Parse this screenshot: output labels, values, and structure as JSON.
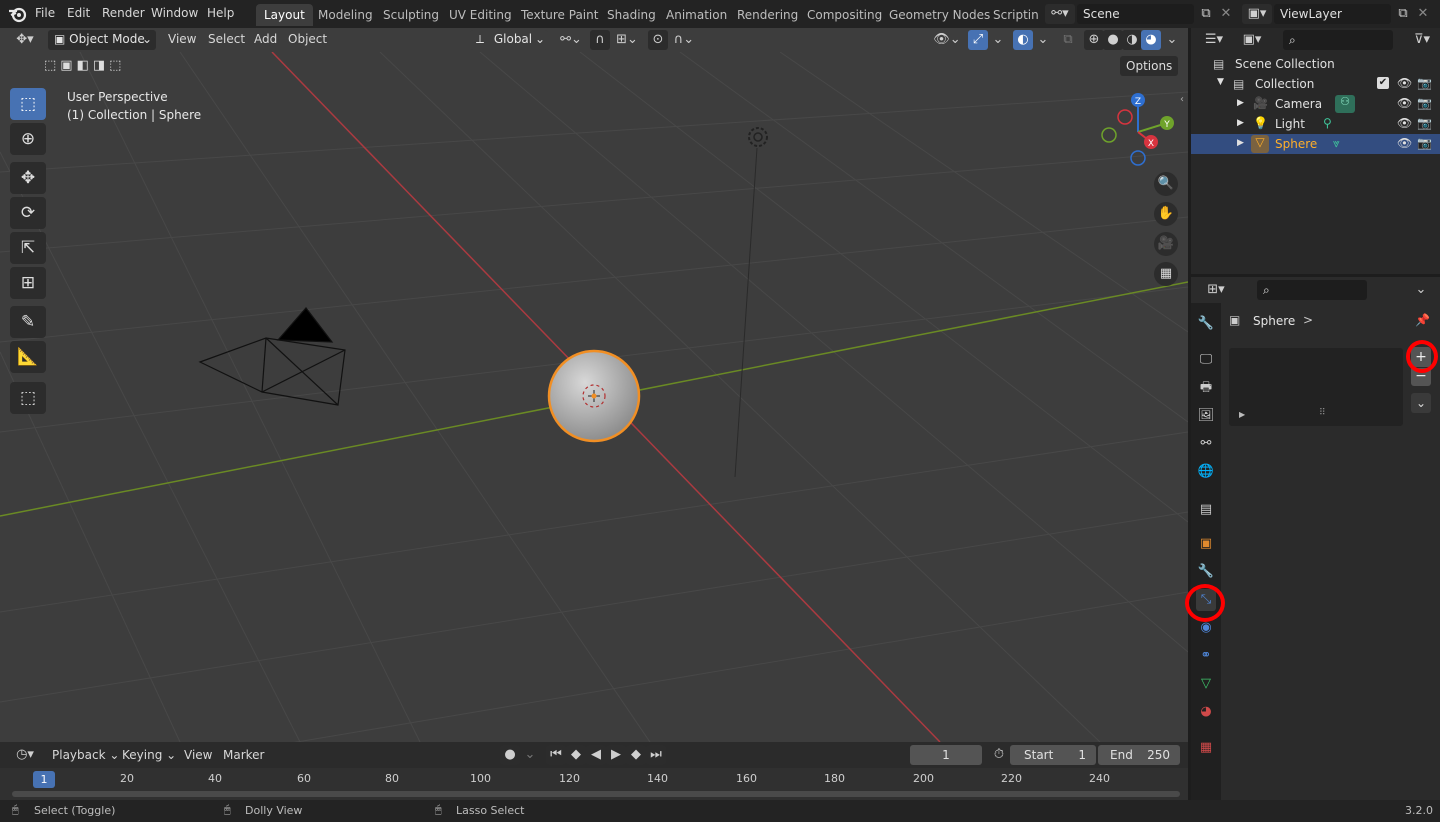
{
  "menu": {
    "items": [
      "File",
      "Edit",
      "Render",
      "Window",
      "Help"
    ]
  },
  "workspaces": [
    "Layout",
    "Modeling",
    "Sculpting",
    "UV Editing",
    "Texture Paint",
    "Shading",
    "Animation",
    "Rendering",
    "Compositing",
    "Geometry Nodes",
    "Scripting"
  ],
  "active_workspace": "Layout",
  "scene": {
    "name": "Scene"
  },
  "view_layer": {
    "name": "ViewLayer"
  },
  "viewport_header": {
    "mode": "Object Mode",
    "view": "View",
    "select": "Select",
    "add": "Add",
    "object": "Object",
    "orientation": "Global",
    "options": "Options"
  },
  "viewport": {
    "perspective": "User Perspective",
    "context": "(1) Collection | Sphere",
    "gizmo_axes": {
      "z": "Z",
      "y": "Y",
      "x": "X"
    }
  },
  "outliner": {
    "root": "Scene Collection",
    "collection": "Collection",
    "items": [
      {
        "name": "Camera",
        "color": "#e0e0e0"
      },
      {
        "name": "Light",
        "color": "#e0e0e0"
      },
      {
        "name": "Sphere",
        "color": "#ffaf29"
      }
    ]
  },
  "properties": {
    "object_name": "Sphere",
    "chevron": ">"
  },
  "timeline": {
    "playback": "Playback",
    "keying": "Keying",
    "view": "View",
    "marker": "Marker",
    "current_frame": "1",
    "start_label": "Start",
    "start": "1",
    "end_label": "End",
    "end": "250",
    "ticks": [
      "1",
      "20",
      "40",
      "60",
      "80",
      "100",
      "120",
      "140",
      "160",
      "180",
      "200",
      "220",
      "240"
    ]
  },
  "statusbar": {
    "select": "Select (Toggle)",
    "dolly": "Dolly View",
    "lasso": "Lasso Select",
    "version": "3.2.0"
  },
  "colors": {
    "accent": "#4772b3",
    "selected_object": "#ffaf29",
    "annotation": "#ff0000",
    "x_axis": "#ab3a40",
    "y_axis": "#6a8a24"
  }
}
